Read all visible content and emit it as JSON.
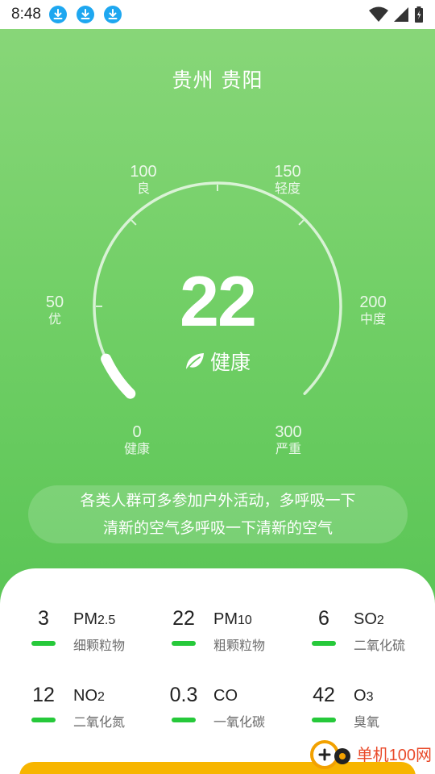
{
  "status_bar": {
    "time": "8:48",
    "icons": [
      "download-icon",
      "download-icon",
      "download-icon",
      "wifi-icon",
      "signal-icon",
      "battery-icon"
    ]
  },
  "location": {
    "city": "贵州 贵阳"
  },
  "gauge": {
    "min": 0,
    "max": 300,
    "value": 22,
    "ticks": [
      {
        "num": "0",
        "name": "健康"
      },
      {
        "num": "50",
        "name": "优"
      },
      {
        "num": "100",
        "name": "良"
      },
      {
        "num": "150",
        "name": "轻度"
      },
      {
        "num": "200",
        "name": "中度"
      },
      {
        "num": "300",
        "name": "严重"
      }
    ],
    "value_label": "22",
    "level_label": "健康",
    "level_icon": "leaf-icon",
    "track_color": "#ffffff"
  },
  "advice": {
    "line1": "各类人群可多参加户外活动，多呼吸一下",
    "line2": "清新的空气多呼吸一下清新的空气"
  },
  "pollutants": [
    {
      "value": "3",
      "code": "PM",
      "sub": "2.5",
      "name": "细颗粒物"
    },
    {
      "value": "22",
      "code": "PM",
      "sub": "10",
      "name": "粗颗粒物"
    },
    {
      "value": "6",
      "code": "SO",
      "sub": "2",
      "name": "二氧化硫"
    },
    {
      "value": "12",
      "code": "NO",
      "sub": "2",
      "name": "二氧化氮"
    },
    {
      "value": "0.3",
      "code": "CO",
      "sub": "",
      "name": "一氧化碳"
    },
    {
      "value": "42",
      "code": "O",
      "sub": "3",
      "name": "臭氧"
    }
  ],
  "watermark": {
    "text": "单机100网"
  },
  "colors": {
    "good_bar": "#26c93a",
    "accent_button": "#f7b500",
    "download_badge": "#1ea7f0"
  }
}
